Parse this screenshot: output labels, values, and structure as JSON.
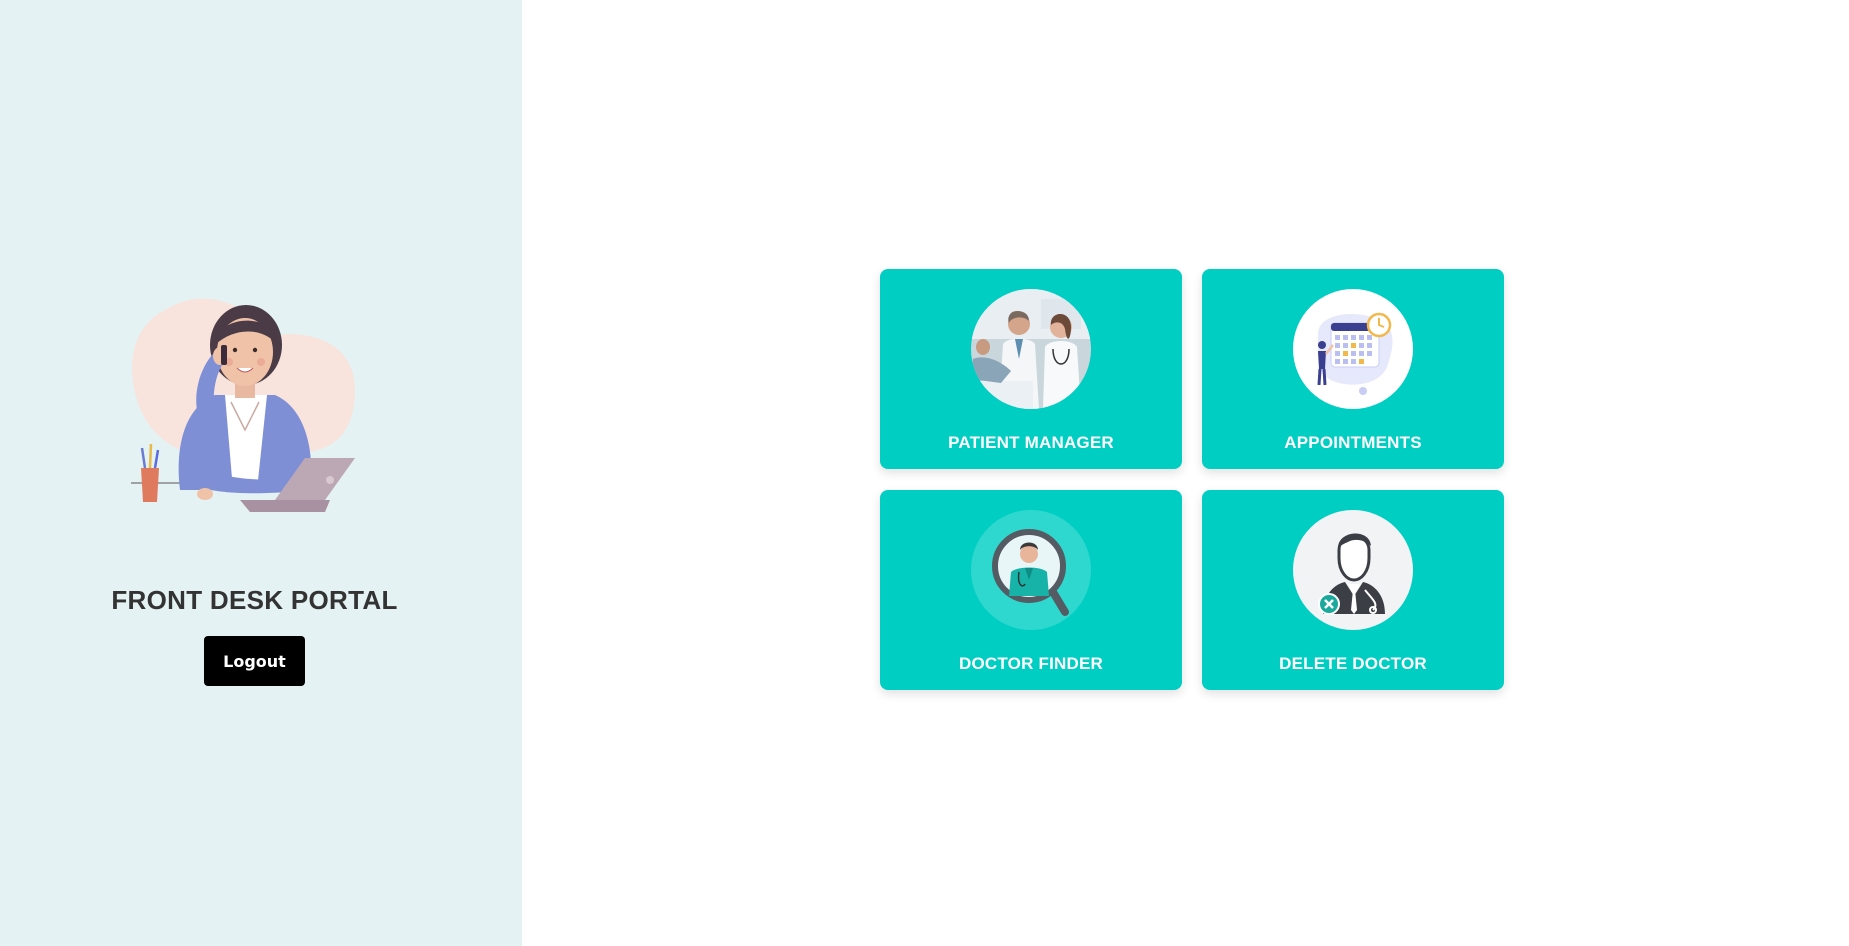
{
  "sidebar": {
    "title": "FRONT DESK PORTAL",
    "logout_label": "Logout",
    "illustration_icon": "receptionist-on-phone-illustration"
  },
  "cards": [
    {
      "label": "PATIENT MANAGER",
      "icon": "doctors-with-patient-photo"
    },
    {
      "label": "APPOINTMENTS",
      "icon": "calendar-illustration"
    },
    {
      "label": "DOCTOR FINDER",
      "icon": "doctor-magnifier-icon"
    },
    {
      "label": "DELETE DOCTOR",
      "icon": "doctor-remove-icon"
    }
  ],
  "colors": {
    "sidebar_bg": "#e4f2f3",
    "card_bg": "#00cec3",
    "button_bg": "#000000"
  }
}
